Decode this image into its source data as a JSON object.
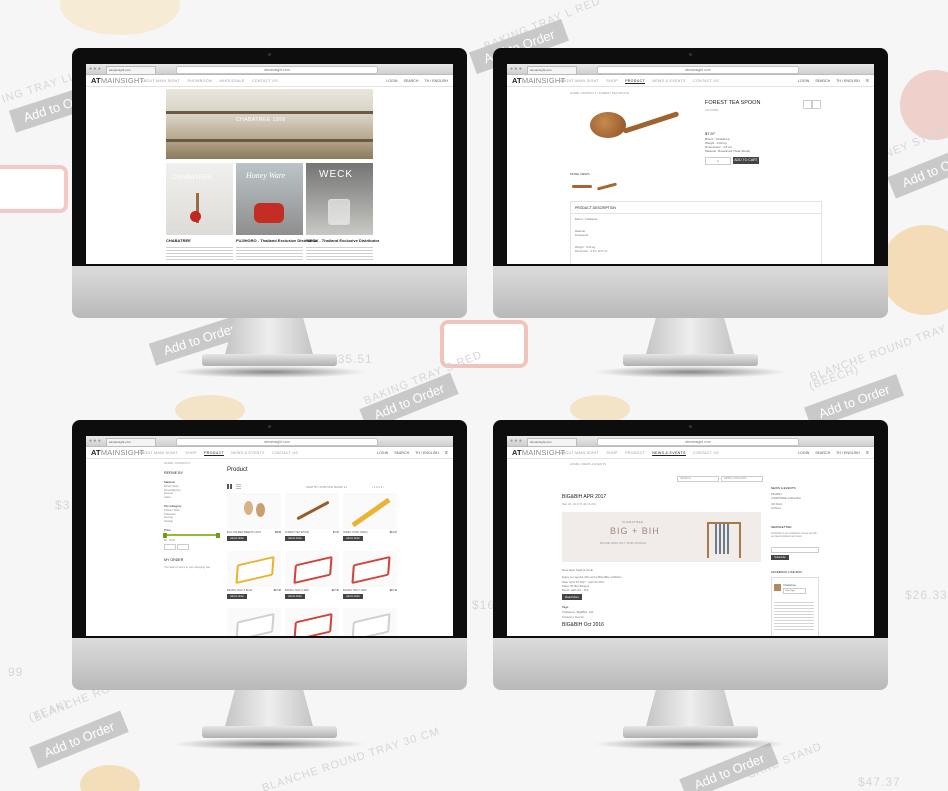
{
  "background": {
    "labels": [
      "BAKING TRAY L RED",
      "ING TRAY LL R",
      "HONEY STICK",
      "NCH ROUND TRAY 24 CM",
      "BAKING TRAY S RED",
      "BLANCHE ROUND TRAY 24 CM",
      "(BEECH)",
      "BLANCHE ROUND TRAY 24 CM",
      "(TEAK)",
      "BLANCHE ROUND TRAY 30 CM",
      "(BEECH)",
      "CAKE STAND",
      "(BEECH)",
      "IN BE",
      "TRAY S BL",
      "T2"
    ],
    "add_to_order": "Add to Order",
    "prices": [
      "$35.51",
      "$26.33",
      "$47.37",
      "$16",
      "$3",
      "99"
    ]
  },
  "site": {
    "logo_main": "AT",
    "logo_mid": "MAINSIGHT",
    "url": "atmainsight.com",
    "nav_home": [
      "ABOUT MAIN SIGHT",
      "SHOWROOM",
      "WHOLESALE",
      "CONTACT US"
    ],
    "nav_other": [
      "ABOUT MAIN SIGHT",
      "SHOP",
      "PRODUCT",
      "NEWS & EVENTS",
      "CONTACT US"
    ],
    "right": [
      "LOGIN",
      "SEARCH",
      "TH / ENGLISH"
    ],
    "right_short": [
      "LOGIN",
      "SEARCH",
      "TH / ENGLISH",
      "☰"
    ]
  },
  "screen1": {
    "banner_text": "CHABATREE 1999",
    "cards": [
      {
        "brand": "CHABATREE",
        "title": "CHABATREE"
      },
      {
        "brand": "Honey Ware",
        "title": "FUJIHORO - Thailand Exclusive Distributor"
      },
      {
        "brand": "WECK",
        "title": "WECK - Thailand Exclusive Distributor"
      }
    ]
  },
  "screen2": {
    "crumb": "HOME / PRODUCT / FOREST TEA SPOON",
    "title": "FOREST TEA SPOON",
    "sku": "CH-FW50",
    "price": "$7.97",
    "details": [
      "Brand : Chabatree",
      "Weight : 0.02 kg",
      "Dimensions : 4.8 cm",
      "Material : Rosewood (Teak Wood)"
    ],
    "qty": "1",
    "add_button": "ADD TO CART",
    "more_views": "MORE VIEWS",
    "desc_title": "PRODUCT DESCRIPTION",
    "desc_lines": [
      "Brand : Chabatree",
      "Material",
      "Rosewood",
      "Weight : 0.02 kg",
      "Dimension : 4.8 x 12.5 cm"
    ]
  },
  "screen3": {
    "crumb": "HOME / PRODUCT",
    "filter_title": "REFINE BY",
    "groups": [
      {
        "title": "Material",
        "items": [
          "Wood (Teak)",
          "Wood (Beech)",
          "Enamel",
          "Glass"
        ]
      },
      {
        "title": "Pet Category",
        "items": [
          "Kitchen Tools",
          "Tableware",
          "Serving",
          "Storage"
        ]
      }
    ],
    "price_title": "Price",
    "price_range": "$0 - $123",
    "my_order": "MY ORDER",
    "order_note": "You have no items in your shopping cart.",
    "heading": "Product",
    "toolbar": "SORT BY: POSITION  SHOW: 12",
    "items": [
      {
        "name": "EGG HOLDER (BEECH) 2 PCS",
        "price": "$8.89"
      },
      {
        "name": "FOREST TEA SPOON",
        "price": "$7.97"
      },
      {
        "name": "HONEY STICK (TEAK)",
        "price": "$14.47"
      },
      {
        "name": "BAKING TRAY S BLUE",
        "price": "$27.20"
      },
      {
        "name": "BAKING TRAY S RED",
        "price": "$27.20"
      },
      {
        "name": "BAKING TRAY L RED",
        "price": "$37.10"
      },
      {
        "name": "",
        "price": ""
      },
      {
        "name": "",
        "price": ""
      },
      {
        "name": "",
        "price": ""
      }
    ],
    "add_label": "Add to Order"
  },
  "screen4": {
    "crumb": "HOME / NEWS & EVENTS",
    "search_label": "SEARCH",
    "filter_label": "NEWS CATEGORY",
    "post_title": "BIG&BIH APR 2017",
    "post_date": "Mar 22, 2017 8:40:16 AM",
    "banner_top": "CHABATREE",
    "banner_main": "BIG + BIH",
    "banner_sub": "BIG+BIH APRIL 2017 | BITEC BANGNA",
    "body_lines": [
      "Meet Main Sight at booth",
      "Enjoy our special offer at the BIG+BIH exhibition",
      "Date: April 20 2017 - April 24 2017",
      "Place: BITEC Bangna",
      "Booth: Hall 101 - 103"
    ],
    "read_more": "Read More",
    "tags_title": "Tags",
    "tag_lines": [
      "Chabatree, Big&BIH, Fair",
      "Posted in: Events"
    ],
    "post2_title": "BIG&BIH Oct 2016",
    "side_blocks": [
      "NEWS & EVENTS",
      "NEWSLETTER",
      "FACEBOOK LIKE BOX"
    ],
    "side_news": [
      "BIG&BIH",
      "CHABATREE at BIG+BIH",
      "Old Posts",
      "Archives"
    ],
    "newsletter_text": "Subscribe to our newsletter to keep up with our latest products and news.",
    "subscribe": "Subscribe",
    "fb_name": "Chabatree",
    "fb_like": "Like Page"
  }
}
